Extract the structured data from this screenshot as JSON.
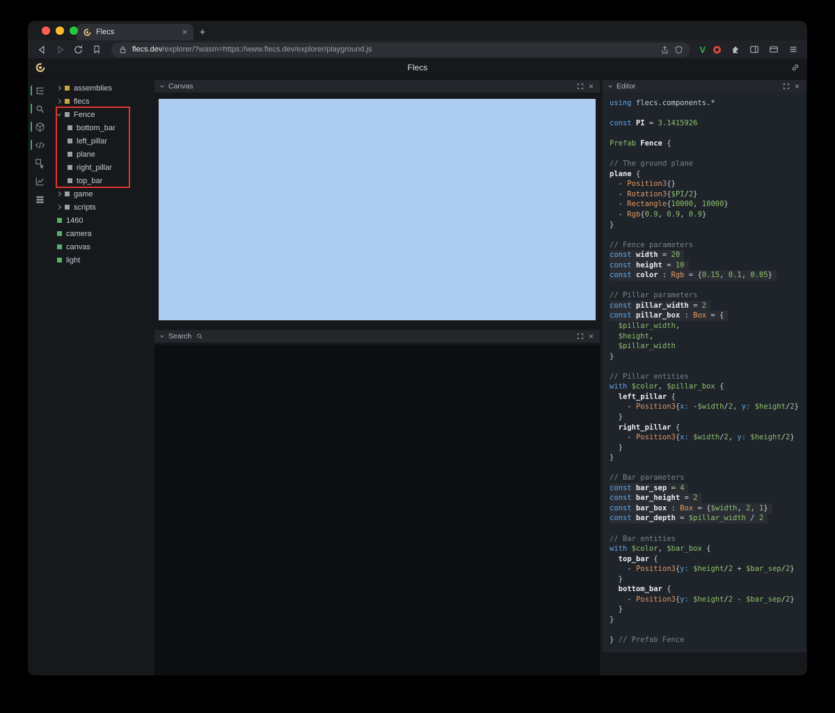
{
  "colors": {
    "kw": "#5fa8ef",
    "kwg": "#8cc16d",
    "ty": "#e29a63",
    "var": "#8cc16d",
    "num": "#8cc16d",
    "cm": "#7b838d",
    "pl": "#c9cfd8",
    "id": "#e9ecf1",
    "mb": "#5fa8ef",
    "accent": "#3fae5a",
    "annotation": "#e0382c",
    "canvas": "#adcdf0",
    "yellow": "#c9a73f",
    "gray": "#99a1a9",
    "green": "#57b36a"
  },
  "glyphs": {
    "close": "×",
    "plus": "+"
  },
  "browser": {
    "tab_title": "Flecs",
    "url_domain": "flecs.dev",
    "url_path": "/explorer/?wasm=https://www.flecs.dev/explorer/playground.js",
    "extension_v_label": "V",
    "icons": [
      "back-icon",
      "forward-icon",
      "reload-icon",
      "bookmark-icon",
      "lock-icon",
      "share-icon",
      "shield-icon",
      "extension-v-icon",
      "extension-red-icon",
      "puzzle-icon",
      "sidebar-panel-icon",
      "wallet-icon",
      "menu-icon",
      "flecs-favicon"
    ]
  },
  "header": {
    "title": "Flecs"
  },
  "sidebar": {
    "icons": [
      {
        "name": "entity-tree-icon",
        "active": true
      },
      {
        "name": "search-icon",
        "active": true
      },
      {
        "name": "cube-icon",
        "active": true
      },
      {
        "name": "code-icon",
        "active": true
      },
      {
        "name": "inspect-icon",
        "active": false
      },
      {
        "name": "chart-icon",
        "active": false
      },
      {
        "name": "rows-icon",
        "active": false
      }
    ]
  },
  "tree": {
    "items": [
      {
        "label": "assemblies",
        "depth": 0,
        "arrow": "right",
        "color": "yellow"
      },
      {
        "label": "flecs",
        "depth": 0,
        "arrow": "right",
        "color": "yellow"
      },
      {
        "label": "Fence",
        "depth": 0,
        "arrow": "down",
        "color": "gray"
      },
      {
        "label": "bottom_bar",
        "depth": 1,
        "color": "gray"
      },
      {
        "label": "left_pillar",
        "depth": 1,
        "color": "gray"
      },
      {
        "label": "plane",
        "depth": 1,
        "color": "gray"
      },
      {
        "label": "right_pillar",
        "depth": 1,
        "color": "gray"
      },
      {
        "label": "top_bar",
        "depth": 1,
        "color": "gray"
      },
      {
        "label": "game",
        "depth": 0,
        "arrow": "right",
        "color": "gray"
      },
      {
        "label": "scripts",
        "depth": 0,
        "arrow": "right",
        "color": "gray"
      },
      {
        "label": "1460",
        "depth": 0,
        "color": "green"
      },
      {
        "label": "camera",
        "depth": 0,
        "color": "green"
      },
      {
        "label": "canvas",
        "depth": 0,
        "color": "green"
      },
      {
        "label": "light",
        "depth": 0,
        "color": "green"
      }
    ]
  },
  "panels": {
    "canvas": {
      "title": "Canvas"
    },
    "search": {
      "title": "Search"
    },
    "editor": {
      "title": "Editor"
    }
  },
  "code": {
    "lines": [
      {
        "t": [
          [
            "kw",
            "using"
          ],
          [
            "pl",
            " flecs.components.*"
          ]
        ]
      },
      {
        "t": []
      },
      {
        "t": [
          [
            "kw",
            "const"
          ],
          [
            "id",
            " PI"
          ],
          [
            "pl",
            " = "
          ],
          [
            "num",
            "3.1415926"
          ]
        ]
      },
      {
        "t": []
      },
      {
        "t": [
          [
            "kwg",
            "Prefab"
          ],
          [
            "id",
            " Fence"
          ],
          [
            "pl",
            " {"
          ]
        ]
      },
      {
        "t": []
      },
      {
        "t": [
          [
            "cm",
            "// The ground plane"
          ]
        ]
      },
      {
        "t": [
          [
            "id",
            "plane"
          ],
          [
            "pl",
            " {"
          ]
        ]
      },
      {
        "t": [
          [
            "pl",
            "  - "
          ],
          [
            "ty",
            "Position3"
          ],
          [
            "pl",
            "{}"
          ]
        ]
      },
      {
        "t": [
          [
            "pl",
            "  - "
          ],
          [
            "ty",
            "Rotation3"
          ],
          [
            "pl",
            "{"
          ],
          [
            "var",
            "$PI"
          ],
          [
            "pl",
            "/"
          ],
          [
            "num",
            "2"
          ],
          [
            "pl",
            "}"
          ]
        ]
      },
      {
        "t": [
          [
            "pl",
            "  - "
          ],
          [
            "ty",
            "Rectangle"
          ],
          [
            "pl",
            "{"
          ],
          [
            "num",
            "10000"
          ],
          [
            "pl",
            ", "
          ],
          [
            "num",
            "10000"
          ],
          [
            "pl",
            "}"
          ]
        ]
      },
      {
        "t": [
          [
            "pl",
            "  - "
          ],
          [
            "ty",
            "Rgb"
          ],
          [
            "pl",
            "{"
          ],
          [
            "num",
            "0.9"
          ],
          [
            "pl",
            ", "
          ],
          [
            "num",
            "0.9"
          ],
          [
            "pl",
            ", "
          ],
          [
            "num",
            "0.9"
          ],
          [
            "pl",
            "}"
          ]
        ]
      },
      {
        "t": [
          [
            "pl",
            "}"
          ]
        ]
      },
      {
        "t": []
      },
      {
        "t": [
          [
            "cm",
            "// Fence parameters"
          ]
        ]
      },
      {
        "hl": true,
        "t": [
          [
            "kw",
            "const"
          ],
          [
            "id",
            " width"
          ],
          [
            "pl",
            " = "
          ],
          [
            "num",
            "20"
          ]
        ]
      },
      {
        "hl": true,
        "t": [
          [
            "kw",
            "const"
          ],
          [
            "id",
            " height"
          ],
          [
            "pl",
            " = "
          ],
          [
            "num",
            "10"
          ]
        ]
      },
      {
        "hl": true,
        "t": [
          [
            "kw",
            "const"
          ],
          [
            "id",
            " color"
          ],
          [
            "pl",
            " : "
          ],
          [
            "ty",
            "Rgb"
          ],
          [
            "pl",
            " = {"
          ],
          [
            "num",
            "0.15"
          ],
          [
            "pl",
            ", "
          ],
          [
            "num",
            "0.1"
          ],
          [
            "pl",
            ", "
          ],
          [
            "num",
            "0.05"
          ],
          [
            "pl",
            "}"
          ]
        ]
      },
      {
        "t": []
      },
      {
        "t": [
          [
            "cm",
            "// Pillar parameters"
          ]
        ]
      },
      {
        "hl": true,
        "t": [
          [
            "kw",
            "const"
          ],
          [
            "id",
            " pillar_width"
          ],
          [
            "pl",
            " = "
          ],
          [
            "num",
            "2"
          ]
        ]
      },
      {
        "hl": true,
        "t": [
          [
            "kw",
            "const"
          ],
          [
            "id",
            " pillar_box"
          ],
          [
            "pl",
            " : "
          ],
          [
            "ty",
            "Box"
          ],
          [
            "pl",
            " = {"
          ]
        ]
      },
      {
        "t": [
          [
            "var",
            "  $pillar_width"
          ],
          [
            "pl",
            ","
          ]
        ]
      },
      {
        "t": [
          [
            "var",
            "  $height"
          ],
          [
            "pl",
            ","
          ]
        ]
      },
      {
        "t": [
          [
            "var",
            "  $pillar_width"
          ]
        ]
      },
      {
        "t": [
          [
            "pl",
            "}"
          ]
        ]
      },
      {
        "t": []
      },
      {
        "t": [
          [
            "cm",
            "// Pillar entities"
          ]
        ]
      },
      {
        "t": [
          [
            "kw",
            "with"
          ],
          [
            "pl",
            " "
          ],
          [
            "var",
            "$color"
          ],
          [
            "pl",
            ", "
          ],
          [
            "var",
            "$pillar_box"
          ],
          [
            "pl",
            " {"
          ]
        ]
      },
      {
        "t": [
          [
            "id",
            "  left_pillar"
          ],
          [
            "pl",
            " {"
          ]
        ]
      },
      {
        "t": [
          [
            "pl",
            "    - "
          ],
          [
            "ty",
            "Position3"
          ],
          [
            "pl",
            "{"
          ],
          [
            "mb",
            "x:"
          ],
          [
            "pl",
            " -"
          ],
          [
            "var",
            "$width"
          ],
          [
            "pl",
            "/"
          ],
          [
            "num",
            "2"
          ],
          [
            "pl",
            ", "
          ],
          [
            "mb",
            "y:"
          ],
          [
            "pl",
            " "
          ],
          [
            "var",
            "$height"
          ],
          [
            "pl",
            "/"
          ],
          [
            "num",
            "2"
          ],
          [
            "pl",
            "}"
          ]
        ]
      },
      {
        "t": [
          [
            "pl",
            "  }"
          ]
        ]
      },
      {
        "t": [
          [
            "id",
            "  right_pillar"
          ],
          [
            "pl",
            " {"
          ]
        ]
      },
      {
        "t": [
          [
            "pl",
            "    - "
          ],
          [
            "ty",
            "Position3"
          ],
          [
            "pl",
            "{"
          ],
          [
            "mb",
            "x:"
          ],
          [
            "pl",
            " "
          ],
          [
            "var",
            "$width"
          ],
          [
            "pl",
            "/"
          ],
          [
            "num",
            "2"
          ],
          [
            "pl",
            ", "
          ],
          [
            "mb",
            "y:"
          ],
          [
            "pl",
            " "
          ],
          [
            "var",
            "$height"
          ],
          [
            "pl",
            "/"
          ],
          [
            "num",
            "2"
          ],
          [
            "pl",
            "}"
          ]
        ]
      },
      {
        "t": [
          [
            "pl",
            "  }"
          ]
        ]
      },
      {
        "t": [
          [
            "pl",
            "}"
          ]
        ]
      },
      {
        "t": []
      },
      {
        "t": [
          [
            "cm",
            "// Bar parameters"
          ]
        ]
      },
      {
        "hl": true,
        "t": [
          [
            "kw",
            "const"
          ],
          [
            "id",
            " bar_sep"
          ],
          [
            "pl",
            " = "
          ],
          [
            "num",
            "4"
          ]
        ]
      },
      {
        "hl": true,
        "t": [
          [
            "kw",
            "const"
          ],
          [
            "id",
            " bar_height"
          ],
          [
            "pl",
            " = "
          ],
          [
            "num",
            "2"
          ]
        ]
      },
      {
        "hl": true,
        "t": [
          [
            "kw",
            "const"
          ],
          [
            "id",
            " bar_box"
          ],
          [
            "pl",
            " : "
          ],
          [
            "ty",
            "Box"
          ],
          [
            "pl",
            " = {"
          ],
          [
            "var",
            "$width"
          ],
          [
            "pl",
            ", "
          ],
          [
            "num",
            "2"
          ],
          [
            "pl",
            ", "
          ],
          [
            "num",
            "1"
          ],
          [
            "pl",
            "}"
          ]
        ]
      },
      {
        "hl": true,
        "t": [
          [
            "kw",
            "const"
          ],
          [
            "id",
            " bar_depth"
          ],
          [
            "pl",
            " = "
          ],
          [
            "var",
            "$pillar_width"
          ],
          [
            "pl",
            " / "
          ],
          [
            "num",
            "2"
          ]
        ]
      },
      {
        "t": []
      },
      {
        "t": [
          [
            "cm",
            "// Bar entities"
          ]
        ]
      },
      {
        "t": [
          [
            "kw",
            "with"
          ],
          [
            "pl",
            " "
          ],
          [
            "var",
            "$color"
          ],
          [
            "pl",
            ", "
          ],
          [
            "var",
            "$bar_box"
          ],
          [
            "pl",
            " {"
          ]
        ]
      },
      {
        "t": [
          [
            "id",
            "  top_bar"
          ],
          [
            "pl",
            " {"
          ]
        ]
      },
      {
        "t": [
          [
            "pl",
            "    - "
          ],
          [
            "ty",
            "Position3"
          ],
          [
            "pl",
            "{"
          ],
          [
            "mb",
            "y:"
          ],
          [
            "pl",
            " "
          ],
          [
            "var",
            "$height"
          ],
          [
            "pl",
            "/"
          ],
          [
            "num",
            "2"
          ],
          [
            "pl",
            " + "
          ],
          [
            "var",
            "$bar_sep"
          ],
          [
            "pl",
            "/"
          ],
          [
            "num",
            "2"
          ],
          [
            "pl",
            "}"
          ]
        ]
      },
      {
        "t": [
          [
            "pl",
            "  }"
          ]
        ]
      },
      {
        "t": [
          [
            "id",
            "  bottom_bar"
          ],
          [
            "pl",
            " {"
          ]
        ]
      },
      {
        "t": [
          [
            "pl",
            "    - "
          ],
          [
            "ty",
            "Position3"
          ],
          [
            "pl",
            "{"
          ],
          [
            "mb",
            "y:"
          ],
          [
            "pl",
            " "
          ],
          [
            "var",
            "$height"
          ],
          [
            "pl",
            "/"
          ],
          [
            "num",
            "2"
          ],
          [
            "pl",
            " - "
          ],
          [
            "var",
            "$bar_sep"
          ],
          [
            "pl",
            "/"
          ],
          [
            "num",
            "2"
          ],
          [
            "pl",
            "}"
          ]
        ]
      },
      {
        "t": [
          [
            "pl",
            "  }"
          ]
        ]
      },
      {
        "t": [
          [
            "pl",
            "}"
          ]
        ]
      },
      {
        "t": []
      },
      {
        "t": [
          [
            "pl",
            "} "
          ],
          [
            "cm",
            "// Prefab Fence"
          ]
        ]
      }
    ]
  }
}
